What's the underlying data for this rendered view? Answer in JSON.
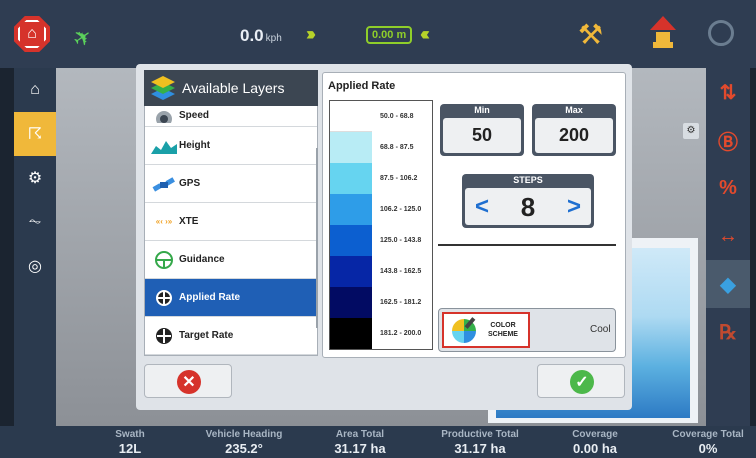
{
  "topbar": {
    "speed_value": "0.0",
    "speed_unit": "kph",
    "offset": "0.00 m"
  },
  "layers": {
    "title": "Available Layers",
    "items": [
      {
        "label": "Speed",
        "icon": "speed-icon"
      },
      {
        "label": "Height",
        "icon": "height-icon"
      },
      {
        "label": "GPS",
        "icon": "gps-icon"
      },
      {
        "label": "XTE",
        "icon": "xte-icon"
      },
      {
        "label": "Guidance",
        "icon": "guidance-icon"
      },
      {
        "label": "Applied Rate",
        "icon": "applied-rate-icon",
        "selected": true
      },
      {
        "label": "Target Rate",
        "icon": "target-rate-icon"
      }
    ]
  },
  "applied_rate": {
    "title": "Applied Rate",
    "ranges": [
      {
        "label": "50.0 - 68.8",
        "color": "#ffffff"
      },
      {
        "label": "68.8 - 87.5",
        "color": "#b8ecf5"
      },
      {
        "label": "87.5 - 106.2",
        "color": "#66d4f0"
      },
      {
        "label": "106.2 - 125.0",
        "color": "#2e9de8"
      },
      {
        "label": "125.0 - 143.8",
        "color": "#0c5fd0"
      },
      {
        "label": "143.8 - 162.5",
        "color": "#0626a6"
      },
      {
        "label": "162.5 - 181.2",
        "color": "#020b63"
      },
      {
        "label": "181.2 - 200.0",
        "color": "#000000"
      }
    ],
    "min_label": "Min",
    "min_value": "50",
    "max_label": "Max",
    "max_value": "200",
    "steps_label": "STEPS",
    "steps_value": "8",
    "scheme_label_1": "COLOR",
    "scheme_label_2": "SCHEME",
    "scheme_value": "Cool"
  },
  "status": {
    "items": [
      {
        "label": "Swath",
        "value": "12L"
      },
      {
        "label": "Vehicle Heading",
        "value": "235.2°"
      },
      {
        "label": "Area Total",
        "value": "31.17 ha"
      },
      {
        "label": "Productive Total",
        "value": "31.17 ha"
      },
      {
        "label": "Coverage",
        "value": "0.00 ha"
      },
      {
        "label": "Coverage Total",
        "value": "0%"
      }
    ]
  },
  "colors": {
    "accent": "#f0b83a",
    "selected": "#1f5fb5",
    "danger": "#d6332b",
    "ok": "#4cb84a"
  }
}
